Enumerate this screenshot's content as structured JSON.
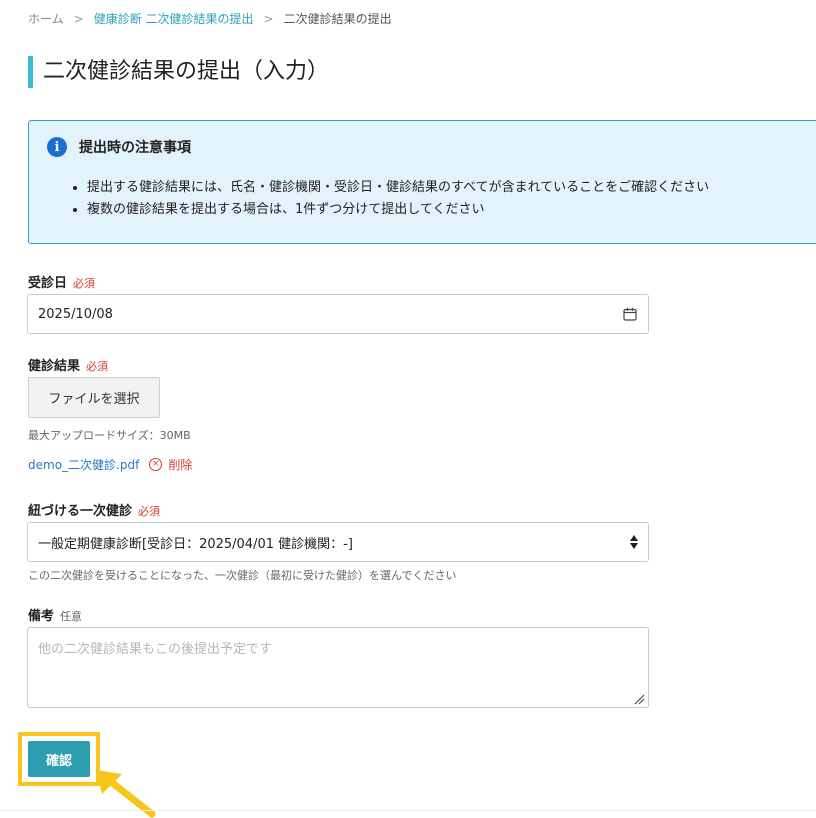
{
  "breadcrumb": {
    "items": [
      "ホーム",
      "健康診断 二次健診結果の提出",
      "二次健診結果の提出"
    ],
    "separator": ">"
  },
  "page": {
    "title": "二次健診結果の提出（入力）"
  },
  "notice": {
    "icon": "info-icon",
    "icon_glyph": "i",
    "title": "提出時の注意事項",
    "items": [
      "提出する健診結果には、氏名・健診機関・受診日・健診結果のすべてが含まれていることをご確認ください",
      "複数の健診結果を提出する場合は、1件ずつ分けて提出してください"
    ]
  },
  "form": {
    "exam_date": {
      "label": "受診日",
      "badge": "必須",
      "value": "2025/10/08",
      "icon": "calendar-icon"
    },
    "result": {
      "label": "健診結果",
      "badge": "必須",
      "button": "ファイルを選択",
      "hint": "最大アップロードサイズ：30MB",
      "file_name": "demo_二次健診.pdf",
      "delete_label": "削除",
      "delete_icon": "close-circle-icon"
    },
    "primary_exam": {
      "label": "紐づける一次健診",
      "badge": "必須",
      "selected": "一般定期健康診断[受診日：2025/04/01 健診機関：-]",
      "hint": "この二次健診を受けることになった、一次健診（最初に受けた健診）を選んでください"
    },
    "remarks": {
      "label": "備考",
      "badge": "任意",
      "placeholder": "他の二次健診結果もこの後提出予定です"
    },
    "confirm_button": "確認"
  },
  "colors": {
    "accent": "#2d9eb0",
    "link": "#2aa3b8",
    "required": "#d43a2f",
    "highlight": "#f7c51c",
    "notice_bg": "#e3f3fb",
    "notice_border": "#2ea2c4"
  }
}
